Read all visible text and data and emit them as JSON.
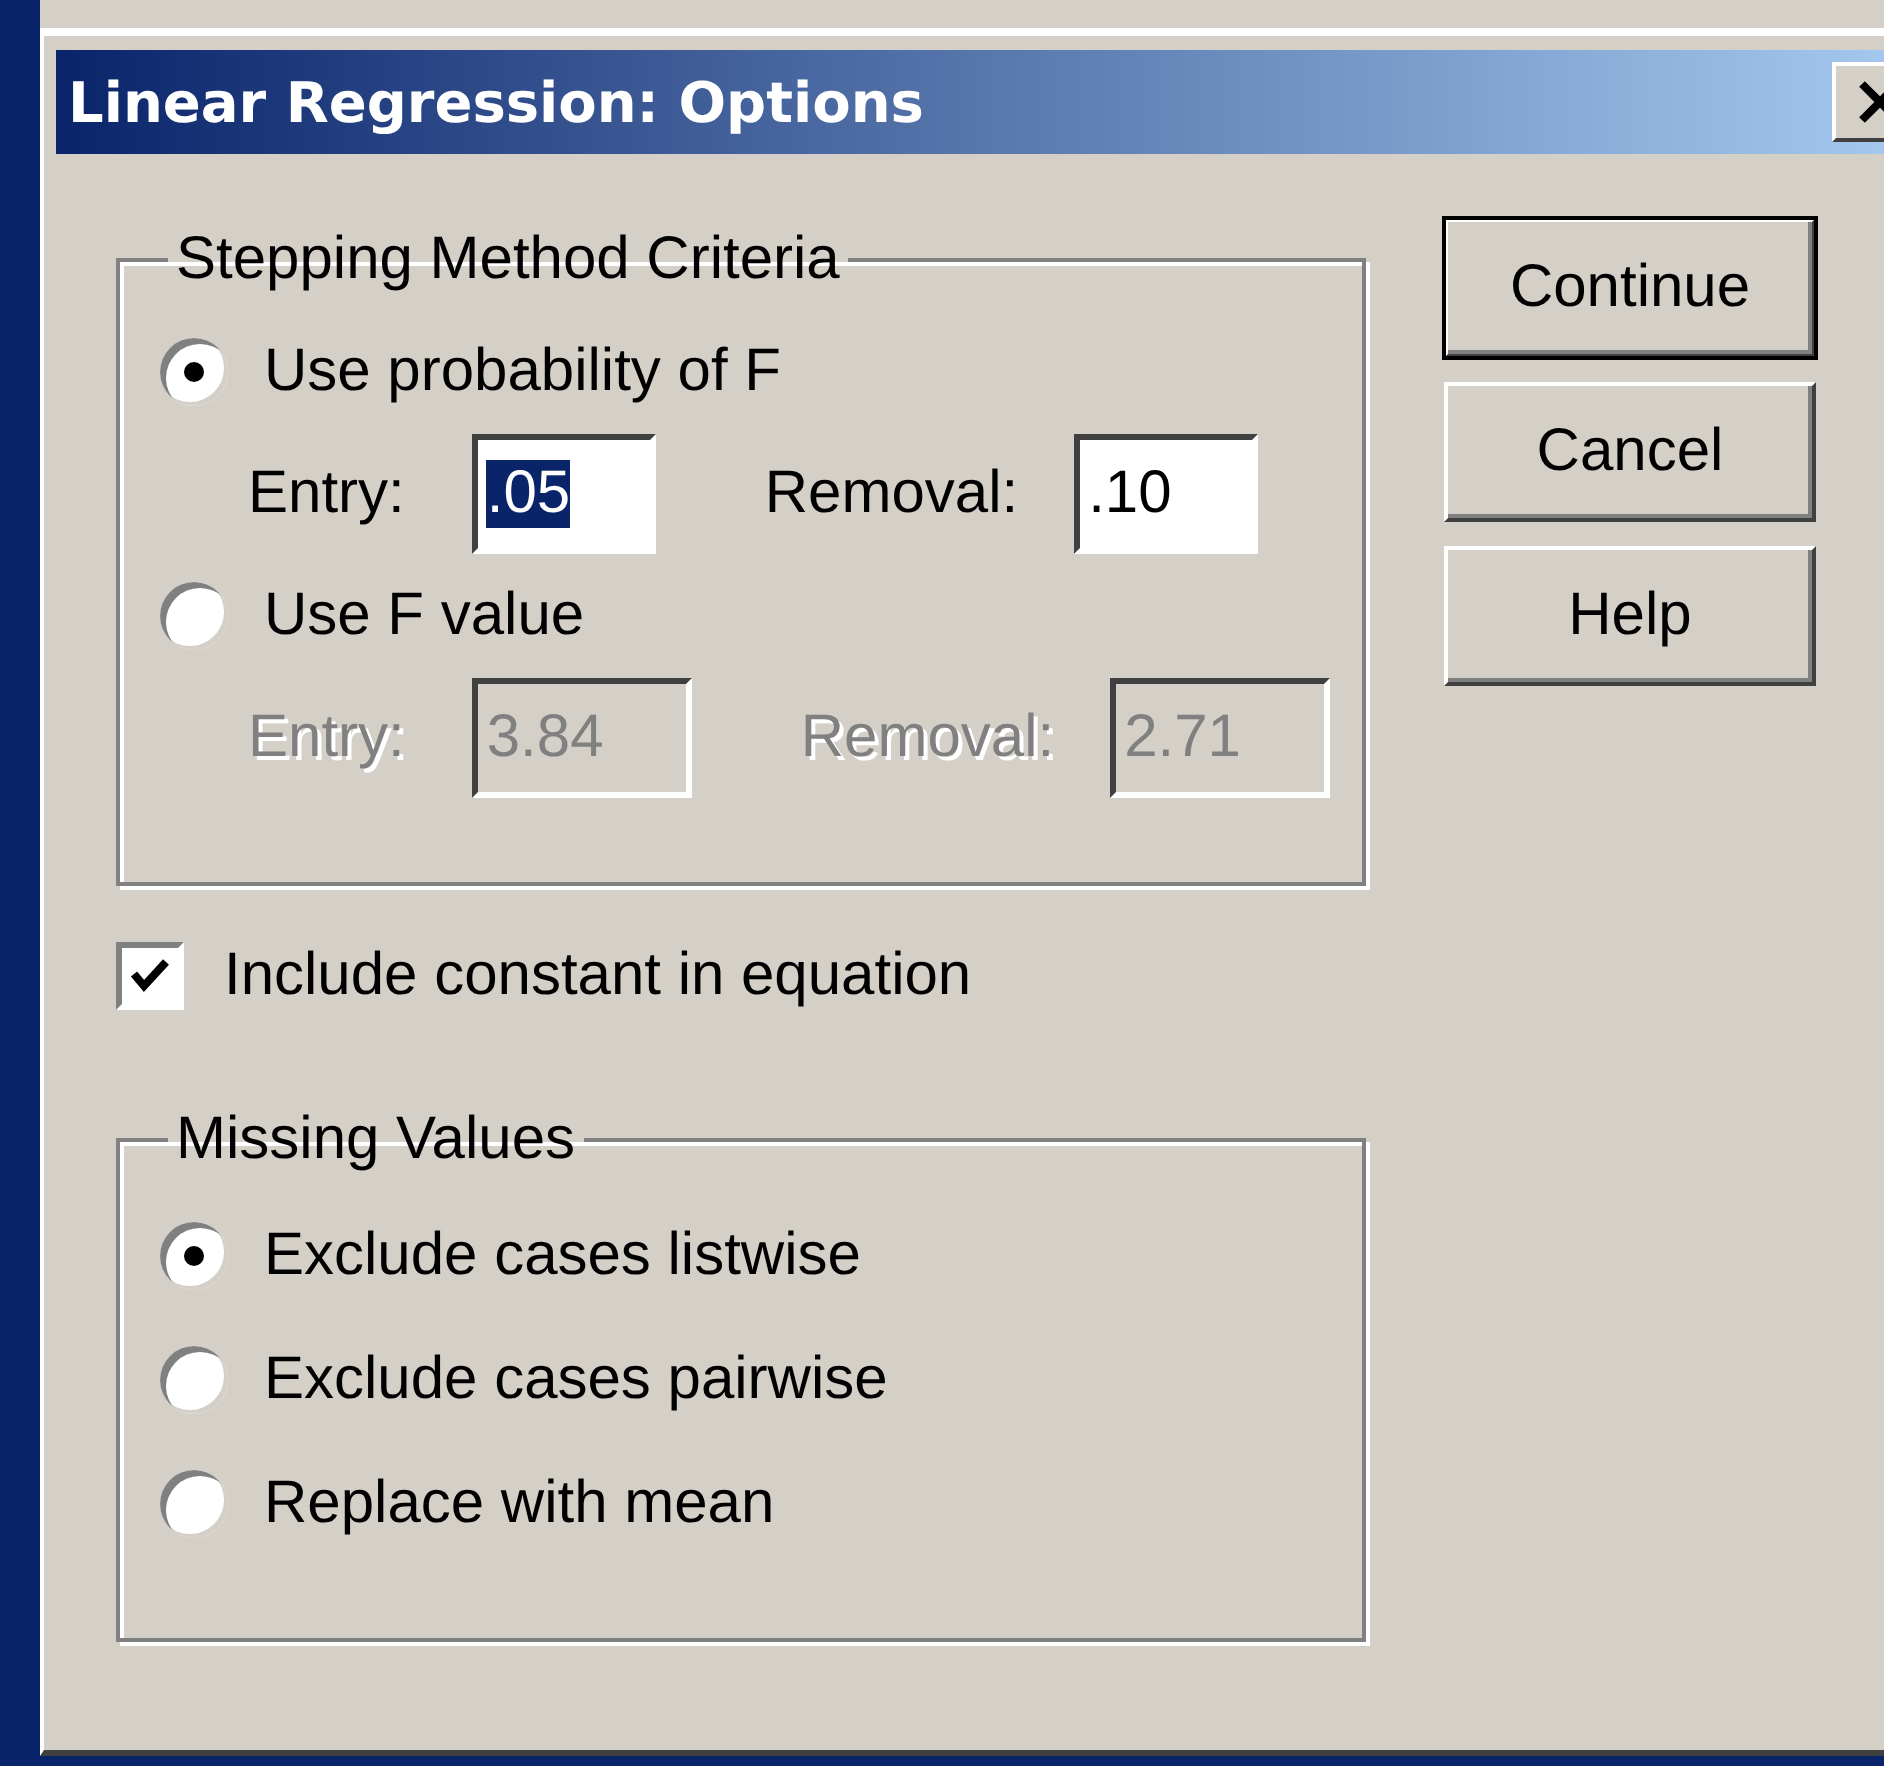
{
  "window": {
    "title": "Linear Regression: Options"
  },
  "stepping_method_criteria": {
    "title": "Stepping Method Criteria",
    "options": [
      {
        "label": "Use probability of F",
        "selected": true,
        "fields": [
          {
            "label": "Entry:",
            "value": ".05",
            "disabled": false,
            "text_selected": true
          },
          {
            "label": "Removal:",
            "value": ".10",
            "disabled": false,
            "text_selected": false
          }
        ]
      },
      {
        "label": "Use F value",
        "selected": false,
        "fields": [
          {
            "label": "Entry:",
            "value": "3.84",
            "disabled": true,
            "text_selected": false
          },
          {
            "label": "Removal:",
            "value": "2.71",
            "disabled": true,
            "text_selected": false
          }
        ]
      }
    ]
  },
  "include_constant": {
    "label": "Include constant in equation",
    "checked": true
  },
  "missing_values": {
    "title": "Missing Values",
    "options": [
      {
        "label": "Exclude cases listwise",
        "selected": true
      },
      {
        "label": "Exclude cases pairwise",
        "selected": false
      },
      {
        "label": "Replace with mean",
        "selected": false
      }
    ]
  },
  "buttons": [
    {
      "label": "Continue",
      "default": true
    },
    {
      "label": "Cancel",
      "default": false
    },
    {
      "label": "Help",
      "default": false
    }
  ]
}
